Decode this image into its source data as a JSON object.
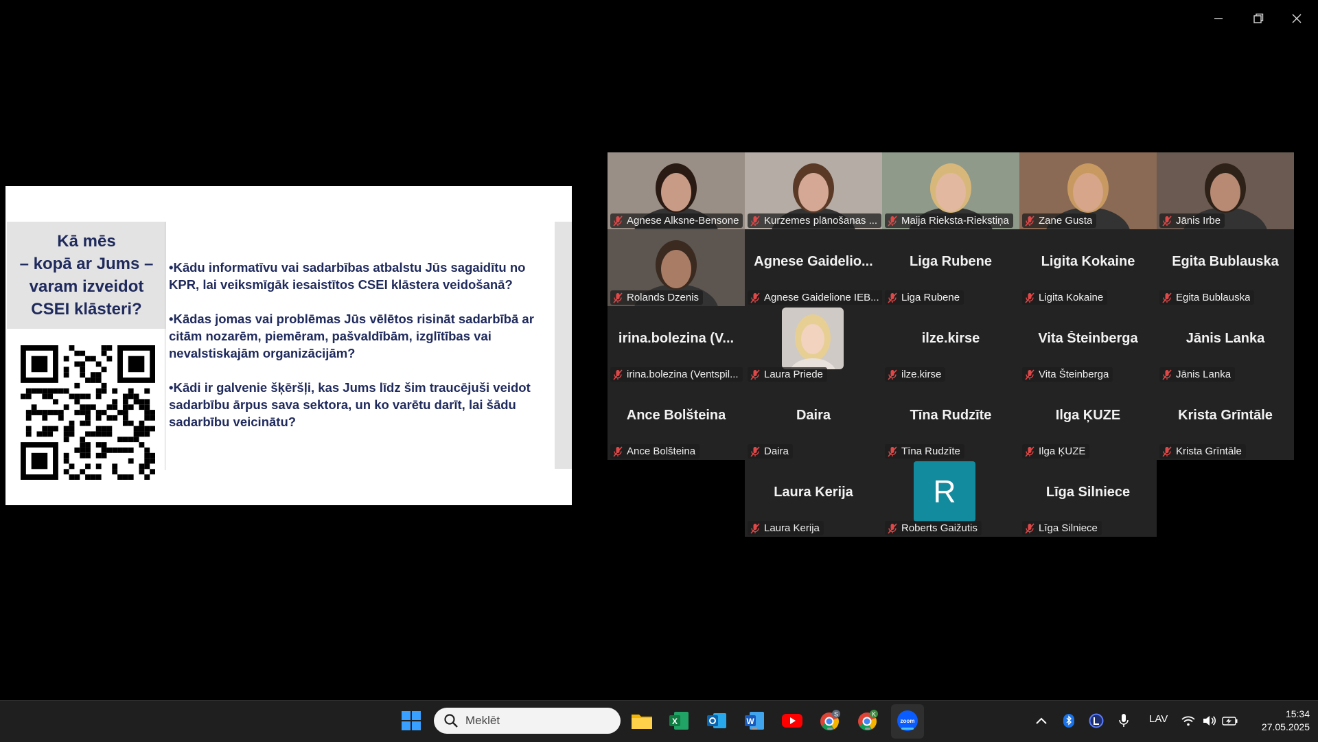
{
  "slide": {
    "title": "Kā mēs\n– kopā ar Jums –\nvaram izveidot\nCSEI klāsteri?",
    "bullets": [
      "•Kādu informatīvu vai sadarbības atbalstu Jūs sagaidītu no KPR, lai veiksmīgāk iesaistītos CSEI klāstera veidošanā?",
      "•Kādas jomas vai problēmas Jūs vēlētos risināt sadarbībā ar citām nozarēm, piemēram, pašvaldībām, izglītības vai nevalstiskajām organizācijām?",
      "•Kādi ir galvenie šķēršļi, kas Jums līdz šim traucējuši veidot sadarbību ārpus sava sektora, un ko varētu darīt, lai šādu sadarbību veicinātu?"
    ]
  },
  "participants": [
    {
      "label": "Agnese Alksne-Bensone",
      "display": "",
      "video": true
    },
    {
      "label": "Kurzemes plānošanas ...",
      "display": "",
      "video": true
    },
    {
      "label": "Maija Rieksta-Riekstiņa",
      "display": "",
      "video": true,
      "speaking": true
    },
    {
      "label": "Zane Gusta",
      "display": "",
      "video": true
    },
    {
      "label": "Jānis Irbe",
      "display": "",
      "video": true
    },
    {
      "label": "Rolands Dzenis",
      "display": "",
      "video": true
    },
    {
      "label": "Agnese Gaidelione IEB...",
      "display": "Agnese  Gaidelio..."
    },
    {
      "label": "Liga Rubene",
      "display": "Liga Rubene"
    },
    {
      "label": "Ligita Kokaine",
      "display": "Ligita Kokaine"
    },
    {
      "label": "Egita Bublauska",
      "display": "Egita Bublauska"
    },
    {
      "label": "irina.bolezina (Ventspil...",
      "display": "irina.bolezina  (V..."
    },
    {
      "label": "Laura Priede",
      "display": "",
      "photo": true
    },
    {
      "label": "ilze.kirse",
      "display": "ilze.kirse"
    },
    {
      "label": "Vita Šteinberga",
      "display": "Vita Šteinberga"
    },
    {
      "label": "Jānis Lanka",
      "display": "Jānis Lanka"
    },
    {
      "label": "Ance Bolšteina",
      "display": "Ance Bolšteina"
    },
    {
      "label": "Daira",
      "display": "Daira"
    },
    {
      "label": "Tīna Rudzīte",
      "display": "Tīna Rudzīte"
    },
    {
      "label": "Ilga ĶUZE",
      "display": "Ilga ĶUZE"
    },
    {
      "label": "Krista Grīntāle",
      "display": "Krista Grīntāle"
    },
    {
      "label": "Laura Kerija",
      "display": "Laura Kerija"
    },
    {
      "label": "Roberts Gaižutis",
      "display": "",
      "avatar": "R"
    },
    {
      "label": "Līga Silniece",
      "display": "Līga Silniece"
    }
  ],
  "taskbar": {
    "search_placeholder": "Meklēt",
    "language": "LAV",
    "time": "15:34",
    "date": "27.05.2025",
    "chrome_profile_1": "S",
    "chrome_profile_2": "K",
    "zoom_label": "zoom"
  },
  "colors": {
    "speaking_border": "#21d47a",
    "slide_text": "#1f2a5c",
    "tile_bg": "#232323",
    "taskbar_bg": "#1f1f1f",
    "avatar_bg": "#138b9e"
  }
}
